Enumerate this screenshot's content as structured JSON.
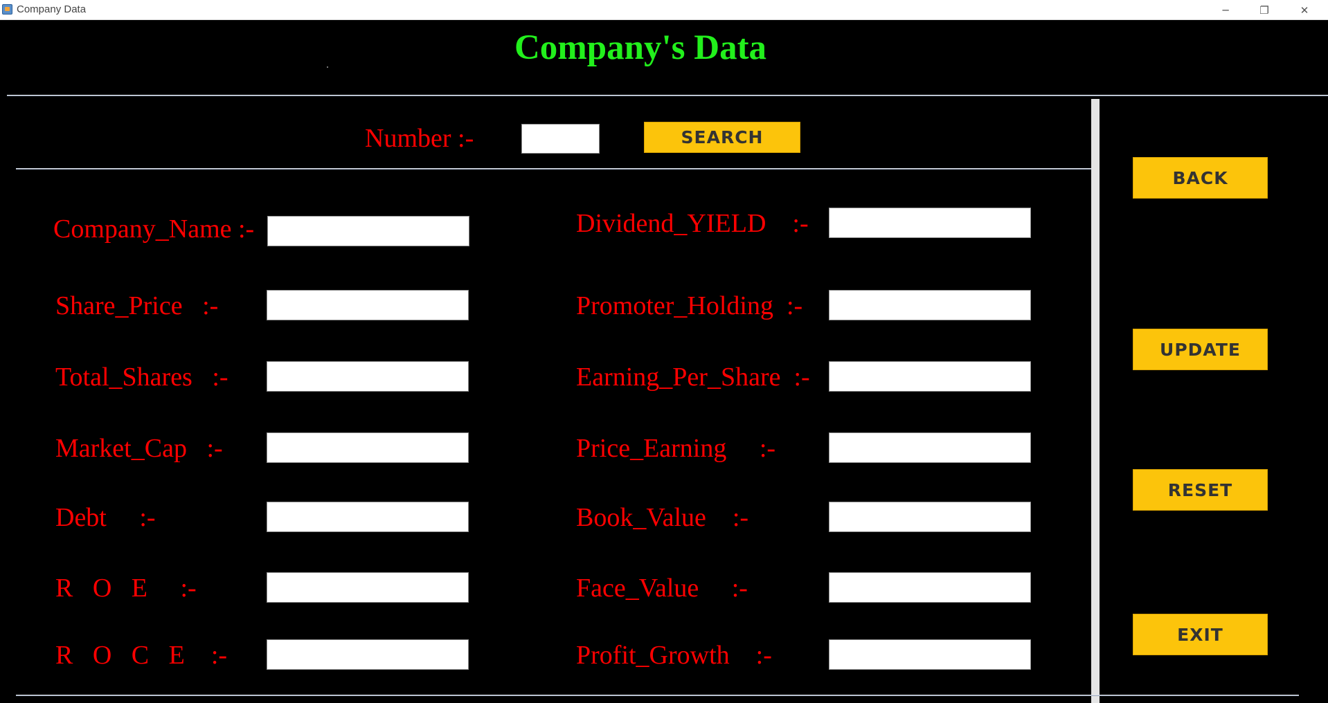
{
  "window": {
    "title": "Company Data",
    "minimize": "─",
    "restore": "❐",
    "close": "✕"
  },
  "page_title": "Company's Data",
  "search": {
    "label": "Number :-",
    "value": "",
    "button": "SEARCH"
  },
  "fields_left": [
    {
      "label": "Company_Name :-",
      "value": ""
    },
    {
      "label": "Share_Price   :-",
      "value": ""
    },
    {
      "label": "Total_Shares   :-",
      "value": ""
    },
    {
      "label": "Market_Cap   :-",
      "value": ""
    },
    {
      "label": "Debt     :-",
      "value": ""
    },
    {
      "label": "R   O   E     :-",
      "value": ""
    },
    {
      "label": "R   O   C   E    :-",
      "value": ""
    }
  ],
  "fields_right": [
    {
      "label": "Dividend_YIELD    :-",
      "value": ""
    },
    {
      "label": "Promoter_Holding  :-",
      "value": ""
    },
    {
      "label": "Earning_Per_Share  :-",
      "value": ""
    },
    {
      "label": "Price_Earning     :-",
      "value": ""
    },
    {
      "label": "Book_Value    :-",
      "value": ""
    },
    {
      "label": "Face_Value     :-",
      "value": ""
    },
    {
      "label": "Profit_Growth    :-",
      "value": ""
    }
  ],
  "side_buttons": {
    "back": "BACK",
    "update": "UPDATE",
    "reset": "RESET",
    "exit": "EXIT"
  },
  "colors": {
    "background": "#000000",
    "title": "#22f01c",
    "labels": "#ff0000",
    "buttons": "#fcc40b"
  }
}
